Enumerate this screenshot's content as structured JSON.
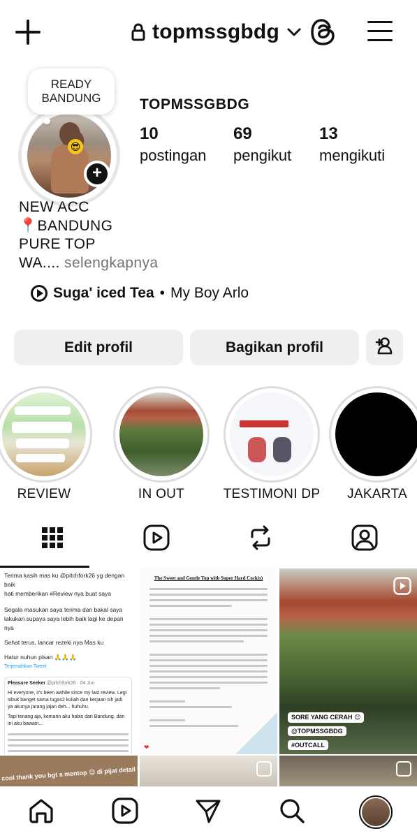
{
  "header": {
    "username": "topmssgbdg",
    "icons": [
      "plus-icon",
      "lock-icon",
      "chevron-down-icon",
      "threads-icon",
      "menu-icon"
    ]
  },
  "note": {
    "line1": "READY",
    "line2": "BANDUNG"
  },
  "profile": {
    "display_name": "TOPMSSGBDG",
    "stats": [
      {
        "value": "10",
        "label": "postingan"
      },
      {
        "value": "69",
        "label": "pengikut"
      },
      {
        "value": "13",
        "label": "mengikuti"
      }
    ],
    "bio_lines": [
      "NEW ACC",
      "📍BANDUNG",
      "PURE TOP",
      "WA...."
    ],
    "more_label": "selengkapnya",
    "music": {
      "title": "Suga' iced Tea",
      "separator": "•",
      "artist": "My Boy Arlo"
    }
  },
  "buttons": {
    "edit": "Edit profil",
    "share": "Bagikan profil"
  },
  "highlights": [
    {
      "label": "REVIEW"
    },
    {
      "label": "IN OUT"
    },
    {
      "label": "TESTIMONI DP"
    },
    {
      "label": "JAKARTA"
    }
  ],
  "tabs": [
    "grid-icon",
    "reels-icon",
    "reposts-icon",
    "tagged-icon"
  ],
  "posts": {
    "p1": {
      "lines": [
        "Terima kasih mas ku @pitchfork26 yg dengan baik",
        "hati memberikan #Review nya buat saya",
        "Segala masukan saya terima dan bakal saya",
        "lakukan supaya saya lebih baik lagi ke depan nya",
        "Sehat terus, lancar rezeki nya Mas ku",
        "Hatur nuhun pisan 🙏🙏🙏",
        "Terjemahkan Tweet"
      ],
      "quote_name": "Pleasure Seeker",
      "quote_handle": "@pitchfork26 · 04 Jun",
      "quote_text": "Hi everyone, it's been awhile since my last review. Legi sibuk banget sama tugas2 kuliah dan kerjaan sih jadi ya akunya jarang jajan deh... huhuhu.",
      "quote_text2": "Tapi tenang aja, kemarin aku habis dari Bandung, dan ini aku bawain..."
    },
    "p2": {
      "title": "The Sweet and Gentle Top with Super Hard Cock(s)"
    },
    "p3": {
      "stickers": [
        "SORE YANG CERAH 😊",
        "@TOPMSSGBDG",
        "#OUTCALL"
      ]
    },
    "row2_caption": "cool thank you bgt a mentop 😊 di pijat detail bgt step by step cok"
  },
  "bottom_nav": [
    "home-icon",
    "reels-icon",
    "send-icon",
    "search-icon",
    "profile-avatar"
  ]
}
